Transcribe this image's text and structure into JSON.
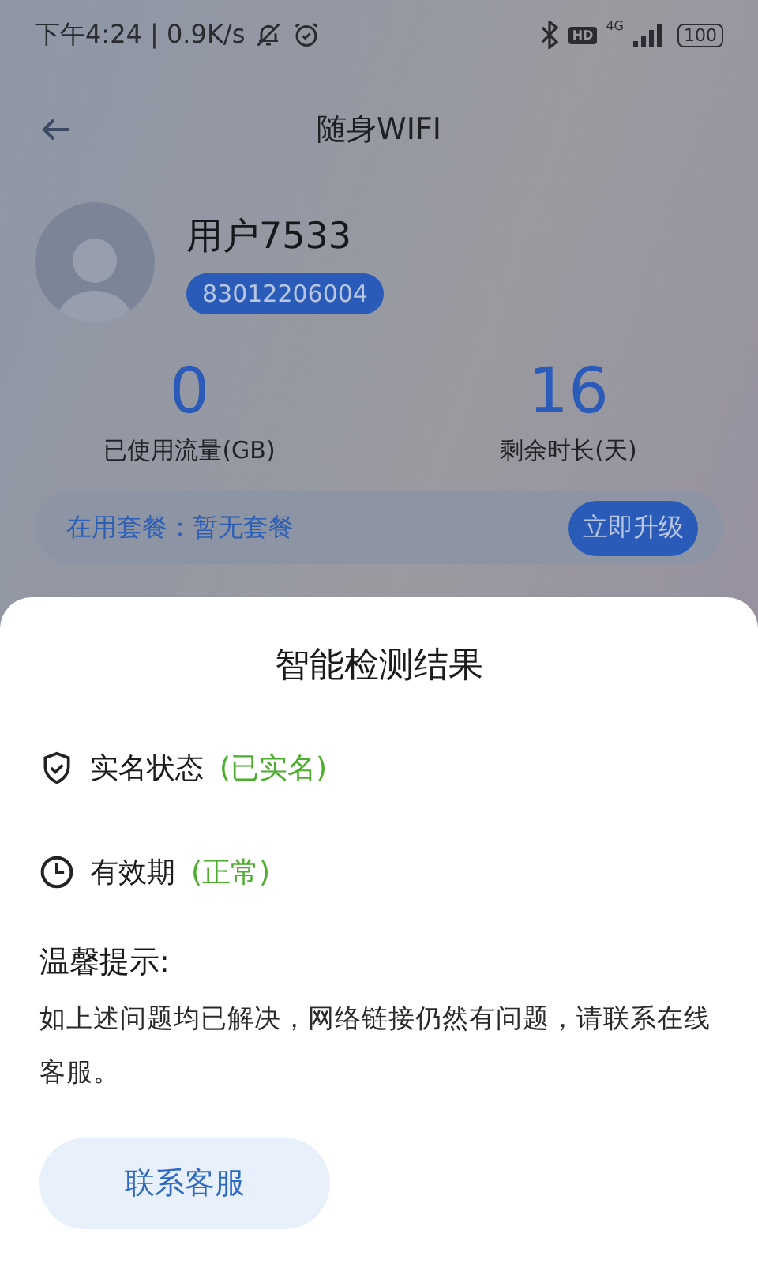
{
  "status_bar": {
    "time_speed": "下午4:24 | 0.9K/s",
    "hd": "HD",
    "network": "4G",
    "battery": "100"
  },
  "header": {
    "title": "随身WIFI"
  },
  "profile": {
    "name": "用户7533",
    "number": "83012206004"
  },
  "stats": [
    {
      "value": "0",
      "label": "已使用流量(GB)"
    },
    {
      "value": "16",
      "label": "剩余时长(天)"
    }
  ],
  "plan": {
    "text": "在用套餐：暂无套餐",
    "button": "立即升级"
  },
  "sheet": {
    "title": "智能检测结果",
    "checks": [
      {
        "kind": "shield",
        "label": "实名状态",
        "status": "(已实名)"
      },
      {
        "kind": "clock",
        "label": "有效期",
        "status": "(正常)"
      }
    ],
    "tip_title": "温馨提示:",
    "tip_text": "如上述问题均已解决，网络链接仍然有问题，请联系在线客服。",
    "button": "联系客服"
  }
}
